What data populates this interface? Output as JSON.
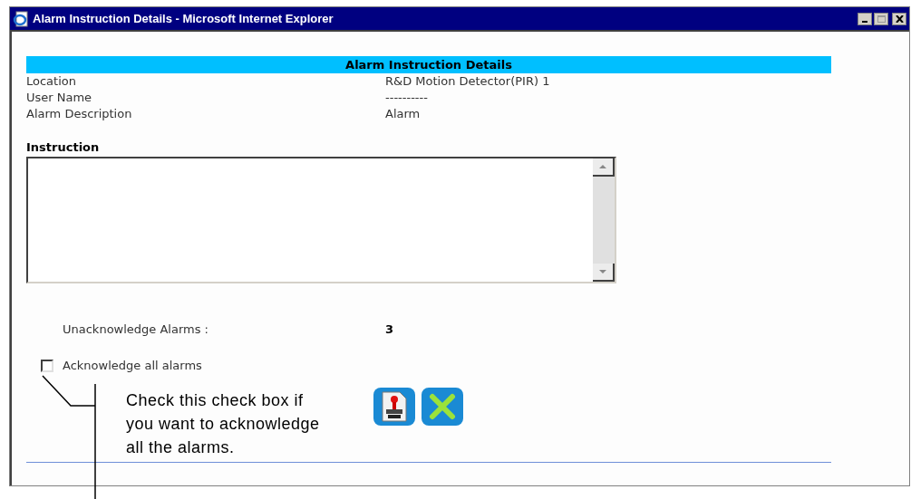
{
  "window": {
    "title": "Alarm Instruction Details - Microsoft Internet Explorer"
  },
  "details": {
    "heading": "Alarm Instruction Details",
    "rows": [
      {
        "label": "Location",
        "value": "R&D Motion Detector(PIR) 1"
      },
      {
        "label": "User Name",
        "value": "----------"
      },
      {
        "label": "Alarm Description",
        "value": "Alarm"
      }
    ]
  },
  "instruction": {
    "label": "Instruction"
  },
  "unacknowledged": {
    "label": "Unacknowledge Alarms :",
    "value": "3"
  },
  "acknowledge_all": {
    "label": "Acknowledge all alarms",
    "checked": false
  },
  "callout": {
    "lines": [
      "Check this check box if",
      "you want to acknowledge",
      "all the alarms."
    ]
  }
}
